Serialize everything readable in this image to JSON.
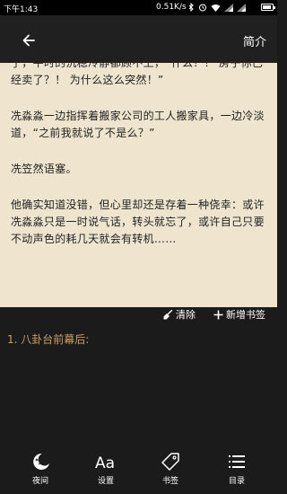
{
  "status_bar": {
    "time": "下午1:43",
    "speed": "0.51K/s",
    "battery_level": 0.85
  },
  "top_bar": {
    "intro_label": "简介"
  },
  "reading": {
    "paragraphs": [
      "了，平时的沉稳冷静都顾不上，“什么？！ 房子你已经卖了？！ 为什么这么突然！”",
      "冼淼淼一边指挥着搬家公司的工人搬家具，一边冷淡道，“之前我就说了不是么？”",
      "冼笠然语塞。",
      "他确实知道没错，但心里却还是存着一种侥幸：或许冼淼淼只是一时说气话，转头就忘了，或许自己只要不动声色的耗几天就会有转机……"
    ]
  },
  "bookmark_panel": {
    "clear_label": "清除",
    "add_label": "新增书签",
    "items": [
      "1. 八卦台前幕后:"
    ]
  },
  "bottom_nav": {
    "items": [
      {
        "label": "夜间",
        "icon": "night-mode-icon"
      },
      {
        "label": "设置",
        "icon": "font-settings-icon"
      },
      {
        "label": "书签",
        "icon": "bookmark-tag-icon"
      },
      {
        "label": "目录",
        "icon": "table-of-contents-icon"
      }
    ]
  },
  "colors": {
    "page_background": "#efe5ce",
    "bookmark_text": "#c8a063",
    "panel_background": "#1b1b1b"
  }
}
